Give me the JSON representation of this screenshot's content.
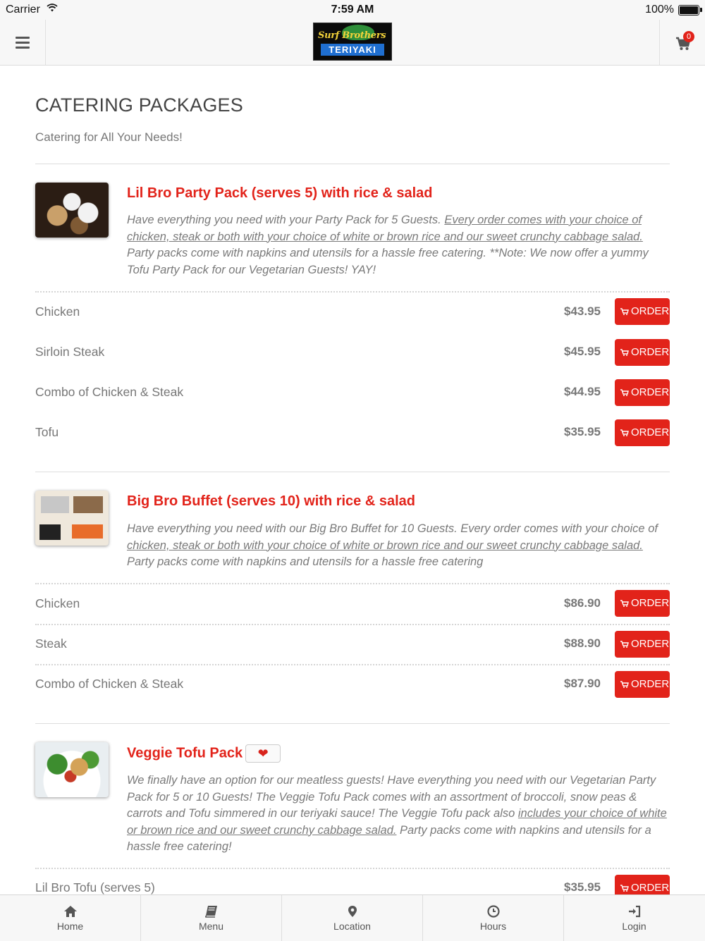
{
  "status_bar": {
    "carrier": "Carrier",
    "time": "7:59 AM",
    "battery": "100%"
  },
  "header": {
    "logo_top": "Surf Brothers",
    "logo_bottom": "TERIYAKI",
    "cart_count": "0"
  },
  "page": {
    "title": "CATERING PACKAGES",
    "subtitle": "Catering for All Your Needs!"
  },
  "order_label": "ORDER",
  "packages": [
    {
      "title": "Lil Bro Party Pack (serves 5) with rice & salad",
      "desc_plain_1": "Have everything you need with your Party Pack for 5 Guests. ",
      "desc_underlined": "Every order comes with your choice of chicken, steak or both with your choice of white or brown rice and our sweet crunchy cabbage salad.",
      "desc_plain_2": " Party packs come with napkins and utensils for a hassle free catering. **Note: We now offer a yummy Tofu Party Pack for our Vegetarian Guests! YAY!",
      "items": [
        {
          "name": "Chicken",
          "price": "$43.95"
        },
        {
          "name": "Sirloin Steak",
          "price": "$45.95"
        },
        {
          "name": "Combo of Chicken & Steak",
          "price": "$44.95"
        },
        {
          "name": "Tofu",
          "price": "$35.95"
        }
      ]
    },
    {
      "title": "Big Bro Buffet (serves 10) with rice & salad",
      "desc_plain_1": "Have everything you need with our Big Bro Buffet for 10 Guests. Every order comes with your choice of ",
      "desc_underlined": "chicken, steak or both with your choice of white or brown rice and our sweet crunchy cabbage salad.",
      "desc_plain_2": " Party packs come with napkins and utensils for a hassle free catering",
      "items": [
        {
          "name": "Chicken",
          "price": "$86.90"
        },
        {
          "name": "Steak",
          "price": "$88.90"
        },
        {
          "name": "Combo of Chicken & Steak",
          "price": "$87.90"
        }
      ]
    },
    {
      "title": "Veggie Tofu Pack",
      "desc_plain_1": "We finally have an option for our meatless guests! Have everything you need with our Vegetarian Party Pack for 5 or 10 Guests! The Veggie Tofu Pack comes with an assortment of broccoli, snow peas & carrots and Tofu simmered in our teriyaki sauce! The Veggie Tofu pack also ",
      "desc_underlined": "includes your choice of white or brown rice and our sweet crunchy cabbage salad.",
      "desc_plain_2": " Party packs come with napkins and utensils for a hassle free catering!",
      "items": [
        {
          "name": "Lil Bro Tofu (serves 5)",
          "price": "$35.95"
        }
      ]
    }
  ],
  "tabs": [
    {
      "label": "Home",
      "icon": "home-icon"
    },
    {
      "label": "Menu",
      "icon": "book-icon"
    },
    {
      "label": "Location",
      "icon": "map-pin-icon"
    },
    {
      "label": "Hours",
      "icon": "clock-icon"
    },
    {
      "label": "Login",
      "icon": "sign-in-icon"
    }
  ],
  "colors": {
    "accent": "#e2231a",
    "text": "#777777",
    "bar_bg": "#f7f7f7"
  }
}
